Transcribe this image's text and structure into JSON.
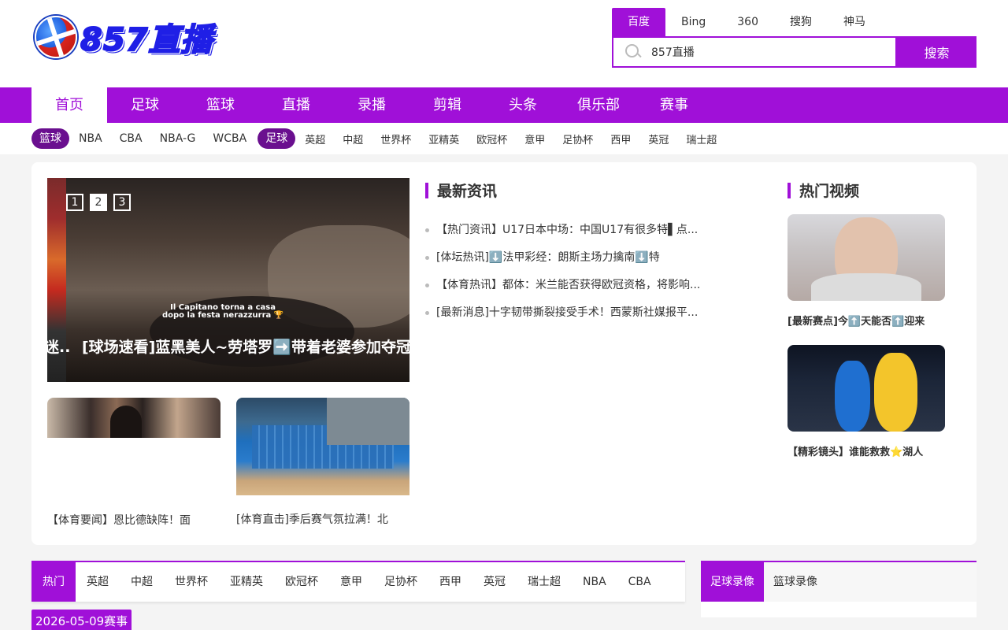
{
  "logo": {
    "text": "857直播"
  },
  "search": {
    "engines": [
      "百度",
      "Bing",
      "360",
      "搜狗",
      "神马"
    ],
    "active_engine": "百度",
    "value": "857直播",
    "button": "搜索"
  },
  "mainnav": [
    "首页",
    "足球",
    "篮球",
    "直播",
    "录播",
    "剪辑",
    "头条",
    "俱乐部",
    "赛事"
  ],
  "subnav": {
    "basketball_cat": "篮球",
    "basketball": [
      "NBA",
      "CBA",
      "NBA-G",
      "WCBA"
    ],
    "football_cat": "足球",
    "football": [
      "英超",
      "中超",
      "世界杯",
      "亚精英",
      "欧冠杯",
      "意甲",
      "足协杯",
      "西甲",
      "英冠",
      "瑞士超"
    ]
  },
  "slider": {
    "pages": [
      "1",
      "2",
      "3"
    ],
    "active_page": "2",
    "prev_caption": "迷..",
    "overlay_line1": "Il Capitano torna a casa",
    "overlay_line2": "dopo la festa nerazzurra 🏆",
    "caption": "[球场速看]蓝黑美人~劳塔罗➡️带着老婆参加夺冠"
  },
  "thumbs": [
    {
      "caption": "【体育要闻】恩比德缺阵！面"
    },
    {
      "caption": "[体育直击]季后赛气氛拉满！北"
    }
  ],
  "latest_news": {
    "title": "最新资讯",
    "items": [
      "【热门资讯】U17日本中场：中国U17有很多特▌点...",
      "[体坛热讯]⬇️法甲彩经：朗斯主场力擒南⬇️特",
      "【体育热讯】都体：米兰能否获得欧冠资格，将影响...",
      "[最新消息]十字韧带撕裂接受手术！西蒙斯社媒报平..."
    ]
  },
  "hot_videos": {
    "title": "热门视频",
    "items": [
      {
        "caption": "[最新赛点]今⬆️天能否⬆️迎来"
      },
      {
        "caption": "【精彩镜头】谁能救救⭐湖人"
      }
    ]
  },
  "bottom_tabs": [
    "热门",
    "英超",
    "中超",
    "世界杯",
    "亚精英",
    "欧冠杯",
    "意甲",
    "足协杯",
    "西甲",
    "英冠",
    "瑞士超",
    "NBA",
    "CBA"
  ],
  "right_tabs": [
    "足球录像",
    "篮球录像"
  ],
  "date_badge": "2026-05-09赛事",
  "colors": {
    "accent": "#a010d8"
  }
}
